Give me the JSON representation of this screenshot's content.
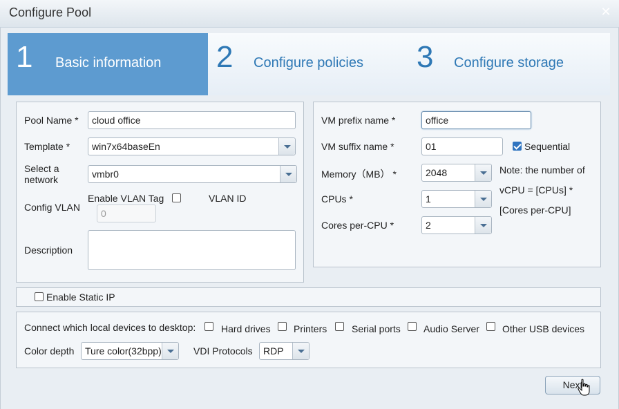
{
  "window": {
    "title": "Configure Pool",
    "close_glyph": "✕"
  },
  "steps": [
    {
      "number": "1",
      "label": "Basic information"
    },
    {
      "number": "2",
      "label": "Configure policies"
    },
    {
      "number": "3",
      "label": "Configure storage"
    }
  ],
  "basic": {
    "pool_name_label": "Pool Name *",
    "pool_name_value": "cloud office",
    "template_label": "Template *",
    "template_value": "win7x64baseEn",
    "network_label": "Select a network",
    "network_value": "vmbr0",
    "config_vlan_label": "Config VLAN",
    "enable_vlan_tag_label": "Enable VLAN Tag",
    "vlan_id_label": "VLAN ID",
    "vlan_id_value": "0",
    "description_label": "Description"
  },
  "vm": {
    "prefix_label": "VM prefix name *",
    "prefix_value": "office",
    "suffix_label": "VM suffix name *",
    "suffix_value": "01",
    "sequential_label": "Sequential",
    "memory_label": "Memory（MB） *",
    "memory_value": "2048",
    "cpus_label": "CPUs *",
    "cpus_value": "1",
    "cores_label": "Cores per-CPU *",
    "cores_value": "2",
    "note_line1": "Note: the number of",
    "note_line2": "vCPU = [CPUs] *",
    "note_line3": "[Cores per-CPU]"
  },
  "static_ip": {
    "label": "Enable Static IP"
  },
  "devices": {
    "label": "Connect which local devices to desktop:",
    "hard_drives": "Hard drives",
    "printers": "Printers",
    "serial_ports": "Serial ports",
    "audio_server": "Audio Server",
    "other_usb": "Other USB devices",
    "color_depth_label": "Color depth",
    "color_depth_value": "Ture color(32bpp)",
    "vdi_label": "VDI Protocols",
    "vdi_value": "RDP"
  },
  "footer": {
    "next_label": "Next"
  },
  "colors": {
    "active_step": "#5d9bd0",
    "step_text": "#2e78b5",
    "checkbox_checked": "#2f74c0"
  }
}
